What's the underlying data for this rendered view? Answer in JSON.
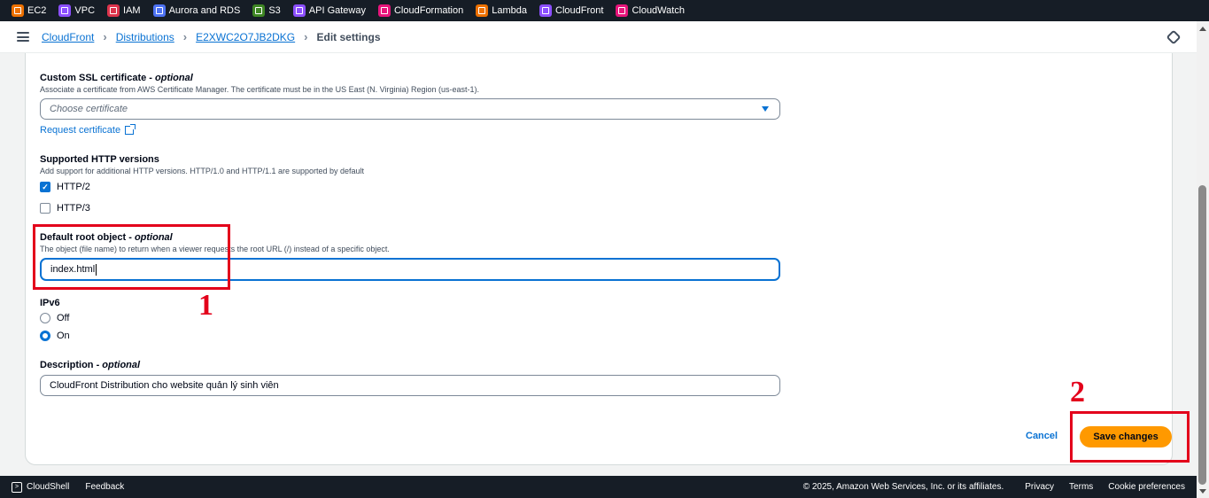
{
  "topbar": {
    "services": [
      {
        "label": "EC2",
        "icon": "ec2-icon",
        "color": "#ed7100"
      },
      {
        "label": "VPC",
        "icon": "vpc-icon",
        "color": "#8c4fff"
      },
      {
        "label": "IAM",
        "icon": "iam-icon",
        "color": "#dd344c"
      },
      {
        "label": "Aurora and RDS",
        "icon": "rds-icon",
        "color": "#4d72f3"
      },
      {
        "label": "S3",
        "icon": "s3-icon",
        "color": "#3f8624"
      },
      {
        "label": "API Gateway",
        "icon": "api-gateway-icon",
        "color": "#8c4fff"
      },
      {
        "label": "CloudFormation",
        "icon": "cloudformation-icon",
        "color": "#e7157b"
      },
      {
        "label": "Lambda",
        "icon": "lambda-icon",
        "color": "#ed7100"
      },
      {
        "label": "CloudFront",
        "icon": "cloudfront-icon",
        "color": "#8c4fff"
      },
      {
        "label": "CloudWatch",
        "icon": "cloudwatch-icon",
        "color": "#e7157b"
      }
    ]
  },
  "breadcrumb": {
    "items": [
      "CloudFront",
      "Distributions",
      "E2XWC2O7JB2DKG"
    ],
    "current": "Edit settings"
  },
  "form": {
    "ssl": {
      "label": "Custom SSL certificate",
      "optional": "optional",
      "description": "Associate a certificate from AWS Certificate Manager. The certificate must be in the US East (N. Virginia) Region (us-east-1).",
      "placeholder": "Choose certificate",
      "request_link": "Request certificate"
    },
    "http": {
      "label": "Supported HTTP versions",
      "description": "Add support for additional HTTP versions. HTTP/1.0 and HTTP/1.1 are supported by default",
      "options": [
        {
          "label": "HTTP/2",
          "checked": true
        },
        {
          "label": "HTTP/3",
          "checked": false
        }
      ]
    },
    "root_object": {
      "label": "Default root object",
      "optional": "optional",
      "description": "The object (file name) to return when a viewer requests the root URL (/) instead of a specific object.",
      "value": "index.html"
    },
    "ipv6": {
      "label": "IPv6",
      "options": [
        {
          "label": "Off",
          "selected": false
        },
        {
          "label": "On",
          "selected": true
        }
      ]
    },
    "description": {
      "label": "Description",
      "optional": "optional",
      "value": "CloudFront Distribution cho website quản lý sinh viên"
    }
  },
  "actions": {
    "cancel": "Cancel",
    "save": "Save changes"
  },
  "annotations": {
    "marker_1": "1",
    "marker_2": "2"
  },
  "footer": {
    "cloudshell": "CloudShell",
    "feedback": "Feedback",
    "copyright": "© 2025, Amazon Web Services, Inc. or its affiliates.",
    "privacy": "Privacy",
    "terms": "Terms",
    "cookies": "Cookie preferences"
  }
}
